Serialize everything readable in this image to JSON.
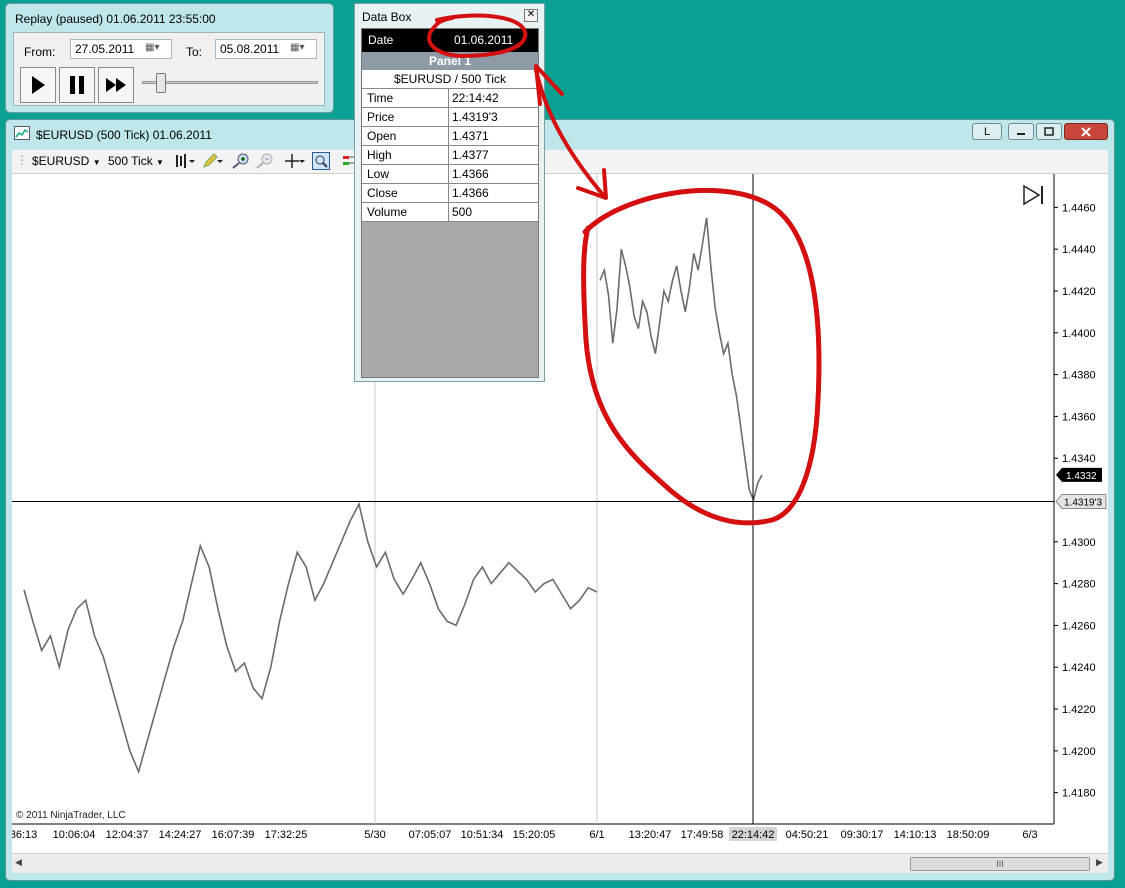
{
  "replay": {
    "title": "Replay (paused) 01.06.2011 23:55:00",
    "from_label": "From:",
    "from_value": "27.05.2011",
    "to_label": "To:",
    "to_value": "05.08.2011",
    "slider_level": 0.08
  },
  "databox": {
    "title": "Data Box",
    "date_label": "Date",
    "date_value": "01.06.2011",
    "panel_label": "Panel 1",
    "symbol_label": "$EURUSD / 500 Tick",
    "rows": [
      {
        "label": "Time",
        "value": "22:14:42"
      },
      {
        "label": "Price",
        "value": "1.4319'3"
      },
      {
        "label": "Open",
        "value": "1.4371"
      },
      {
        "label": "High",
        "value": "1.4377"
      },
      {
        "label": "Low",
        "value": "1.4366"
      },
      {
        "label": "Close",
        "value": "1.4366"
      },
      {
        "label": "Volume",
        "value": "500"
      }
    ]
  },
  "chart_window": {
    "title": "$EURUSD (500 Tick)  01.06.2011",
    "layout_button": "L",
    "toolbar": {
      "instrument": "$EURUSD",
      "interval": "500 Tick"
    },
    "copyright": "© 2011 NinjaTrader, LLC",
    "scroll_label": "III"
  },
  "chart_data": {
    "type": "line",
    "title": "",
    "y_ticks": [
      "1.4460",
      "1.4440",
      "1.4420",
      "1.4400",
      "1.4380",
      "1.4360",
      "1.4340",
      "1.4300",
      "1.4280",
      "1.4260",
      "1.4240",
      "1.4220",
      "1.4200",
      "1.4180"
    ],
    "ylim": [
      1.4165,
      1.4475
    ],
    "x_ticks": [
      ":36:13",
      "10:06:04",
      "12:04:37",
      "14:24:27",
      "16:07:39",
      "17:32:25",
      "5/30",
      "07:05:07",
      "10:51:34",
      "15:20:05",
      "6/1",
      "13:20:47",
      "17:49:58",
      "22:14:42",
      "04:50:21",
      "09:30:17",
      "14:10:13",
      "18:50:09",
      "6/3"
    ],
    "session_dividers": [
      "5/30",
      "6/1"
    ],
    "last_price_label": "1.4332",
    "last_price": 1.4332,
    "crosshair_price_label": "1.4319'3",
    "crosshair_price": 1.43193,
    "crosshair_time": "22:14:42",
    "series": [
      {
        "values": [
          1.4277,
          1.4262,
          1.4248,
          1.4255,
          1.424,
          1.4258,
          1.4268,
          1.4272,
          1.4255,
          1.4245,
          1.423,
          1.4215,
          1.42,
          1.419,
          1.4205,
          1.422,
          1.4235,
          1.425,
          1.4262,
          1.428,
          1.4298,
          1.4288,
          1.4268,
          1.425,
          1.4238,
          1.4242,
          1.423,
          1.4225,
          1.424,
          1.4262,
          1.428,
          1.4295,
          1.4288,
          1.4272,
          1.428,
          1.429,
          1.43,
          1.431,
          1.4318,
          1.43,
          1.4288,
          1.4295,
          1.4282,
          1.4275,
          1.4282,
          1.429,
          1.428,
          1.4268,
          1.4262,
          1.426,
          1.427,
          1.4282,
          1.4288,
          1.428,
          1.4285,
          1.429,
          1.4286,
          1.4282,
          1.4276,
          1.428,
          1.4282,
          1.4275,
          1.4268,
          1.4272,
          1.4278,
          1.4276
        ]
      },
      {
        "values": [
          1.4425,
          1.443,
          1.4418,
          1.4395,
          1.4412,
          1.444,
          1.4432,
          1.4422,
          1.4408,
          1.4402,
          1.4415,
          1.441,
          1.4398,
          1.439,
          1.4405,
          1.442,
          1.4415,
          1.4425,
          1.4432,
          1.442,
          1.441,
          1.4422,
          1.4438,
          1.443,
          1.4442,
          1.4455,
          1.4432,
          1.4412,
          1.44,
          1.439,
          1.4395,
          1.438,
          1.437,
          1.4355,
          1.434,
          1.4325,
          1.432,
          1.4328,
          1.4332
        ]
      }
    ]
  }
}
